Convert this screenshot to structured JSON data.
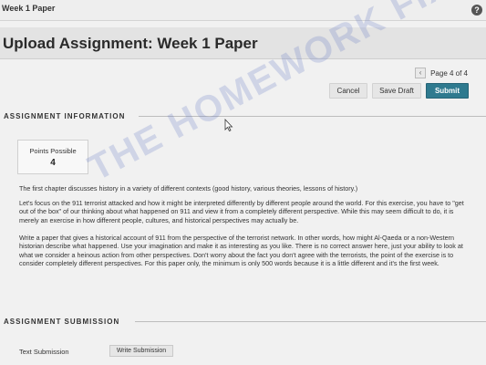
{
  "topbar": {
    "breadcrumb": "Week 1 Paper",
    "help_icon": "?"
  },
  "page": {
    "title": "Upload Assignment: Week 1 Paper"
  },
  "pager": {
    "text": "Page 4 of 4",
    "prev_icon": "‹"
  },
  "toolbar": {
    "cancel_label": "Cancel",
    "save_draft_label": "Save Draft",
    "submit_label": "Submit"
  },
  "assignment_info": {
    "heading": "ASSIGNMENT INFORMATION",
    "points_label": "Points Possible",
    "points_value": "4",
    "paragraphs": [
      "The first chapter discusses history in a variety of different contexts (good history, various theories, lessons of history.)",
      "Let's focus on the 911 terrorist attacked and how it might be interpreted differently by different people around the world. For this exercise, you have to \"get out of the box\" of our thinking about what happened on 911 and view it from a completely different perspective.  While this may seem difficult to do, it is merely an exercise in how different people, cultures, and historical perspectives may actually be.",
      "Write a paper that gives a historical account of 911 from the perspective of the terrorist network.  In other words, how might Al-Qaeda or a non-Western historian describe what happened.  Use your imagination and make it as interesting as you like.  There is no correct answer here, just your ability to look at what we consider a heinous action from other perspectives.  Don't worry about the fact you don't agree with the terrorists, the point of the exercise is to consider completely different perspectives.  For this paper only, the minimum is only 500 words because it is a little different and it's the first week."
    ]
  },
  "submission": {
    "heading": "ASSIGNMENT SUBMISSION",
    "text_submission_label": "Text Submission",
    "write_button_label": "Write Submission"
  },
  "watermark": "THE HOMEWORK FIX",
  "colors": {
    "submit_bg": "#2f7a8f",
    "page_bg": "#f1f1f1",
    "watermark": "#586ebe"
  }
}
